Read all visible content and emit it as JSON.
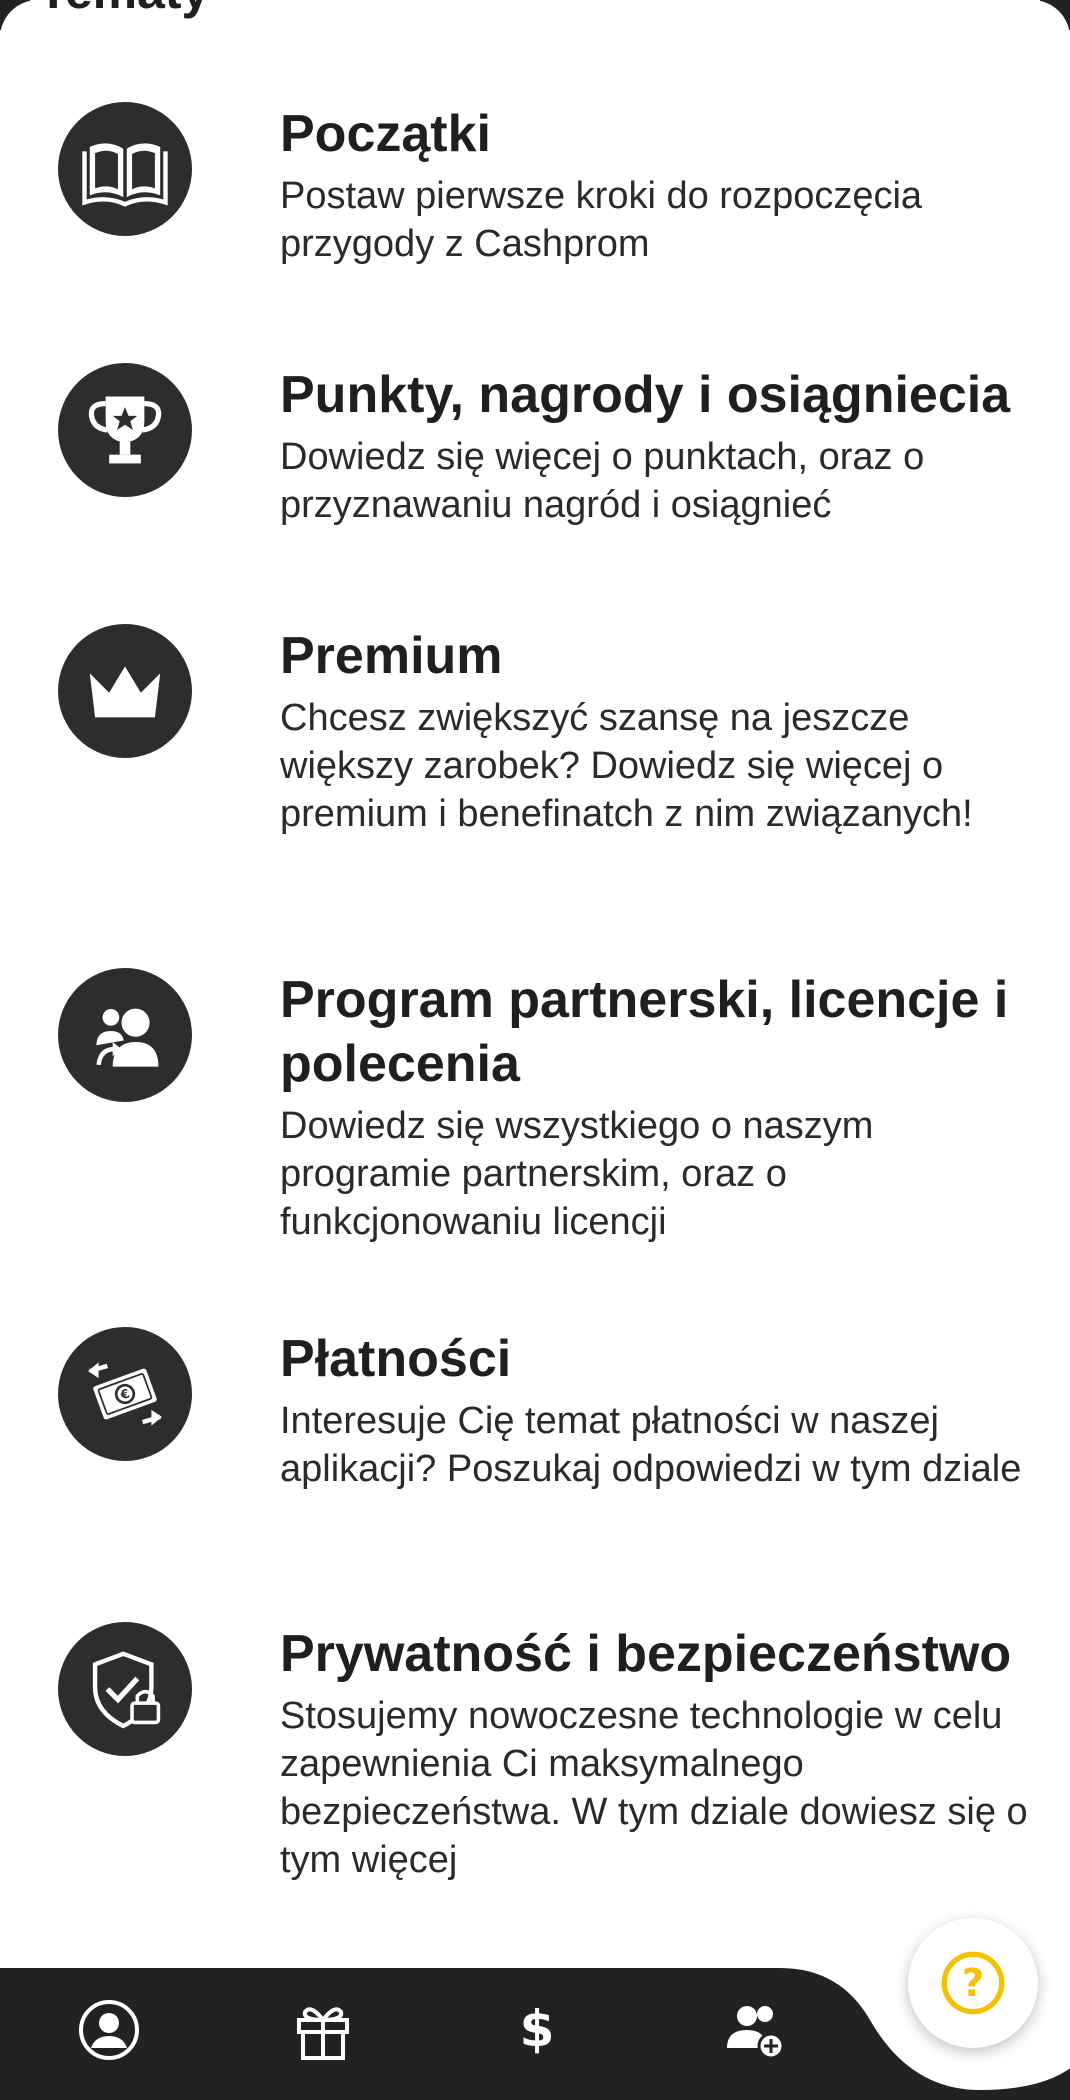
{
  "page": {
    "partial_title": "Tematy"
  },
  "topics": [
    {
      "title": "Początki",
      "description": "Postaw pierwsze kroki do rozpoczęcia przygody z Cashprom",
      "icon": "book-icon"
    },
    {
      "title": "Punkty, nagrody i osiągniecia",
      "description": "Dowiedz się więcej o punktach, oraz o przyznawaniu nagród i osiągnieć",
      "icon": "trophy-icon"
    },
    {
      "title": "Premium",
      "description": "Chcesz zwiększyć szansę na jeszcze większy zarobek? Dowiedz się więcej o premium i benefinatch z nim związanych!",
      "icon": "crown-icon"
    },
    {
      "title": "Program partnerski, licencje i polecenia",
      "description": "Dowiedz się wszystkiego o naszym programie partnerskim, oraz o funkcjonowaniu licencji",
      "icon": "users-referral-icon"
    },
    {
      "title": "Płatności",
      "description": "Interesuje Cię temat płatności w naszej aplikacji? Poszukaj odpowiedzi w tym dziale",
      "icon": "money-exchange-icon"
    },
    {
      "title": "Prywatność i bezpieczeństwo",
      "description": "Stosujemy nowoczesne technologie w celu zapewnienia Ci maksymalnego bezpieczeństwa. W tym dziale dowiesz się o tym więcej",
      "icon": "shield-lock-icon"
    }
  ],
  "bottom_nav": {
    "items": [
      "profile-icon",
      "gift-icon",
      "dollar-icon",
      "add-friend-icon"
    ],
    "help": "help-icon"
  },
  "colors": {
    "icon_bg": "#2d2d2d",
    "nav_bg": "#222222",
    "accent": "#f2c200",
    "text": "#1f1f1f"
  }
}
